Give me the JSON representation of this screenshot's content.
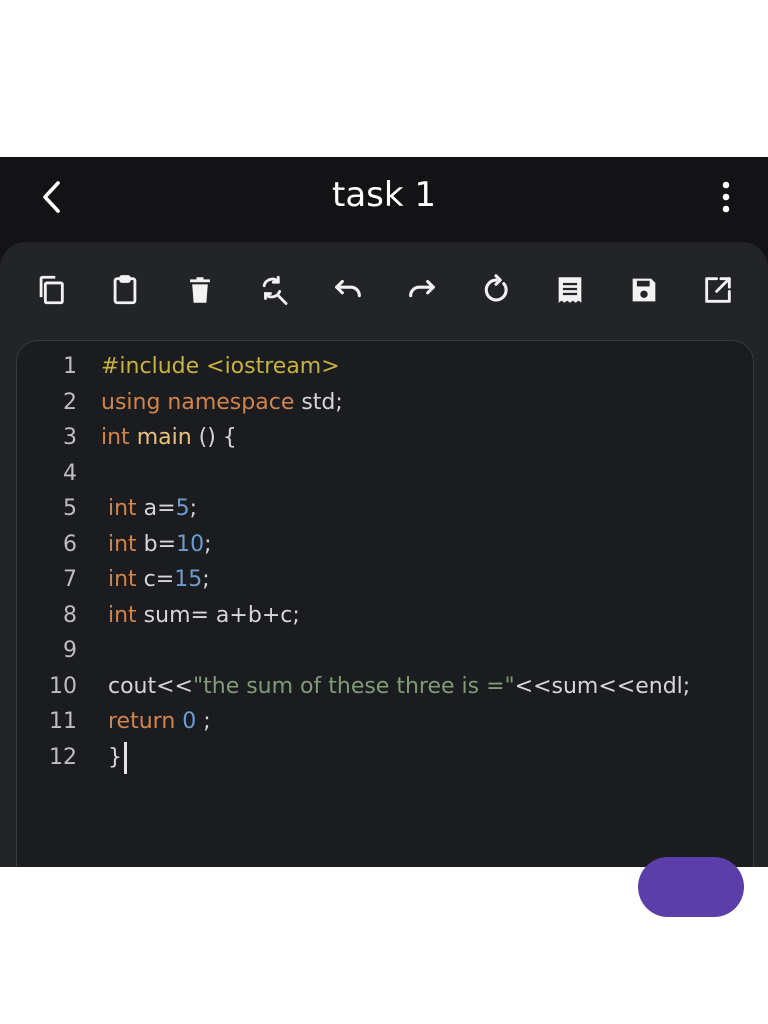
{
  "appbar": {
    "title": "task 1",
    "back_icon": "chevron-left-icon",
    "more_icon": "more-vertical-icon"
  },
  "toolbar": {
    "tools": [
      {
        "name": "copy",
        "icon": "copy-icon"
      },
      {
        "name": "paste",
        "icon": "clipboard-icon"
      },
      {
        "name": "delete",
        "icon": "trash-icon"
      },
      {
        "name": "find-replace",
        "icon": "find-replace-icon"
      },
      {
        "name": "undo",
        "icon": "undo-icon"
      },
      {
        "name": "redo",
        "icon": "redo-icon"
      },
      {
        "name": "reset",
        "icon": "refresh-icon"
      },
      {
        "name": "log",
        "icon": "receipt-icon"
      },
      {
        "name": "save",
        "icon": "save-icon"
      },
      {
        "name": "open-external",
        "icon": "open-external-icon"
      }
    ]
  },
  "editor": {
    "lines": [
      {
        "num": "1",
        "tokens": [
          {
            "t": "#include <iostream>",
            "c": "pre"
          }
        ]
      },
      {
        "num": "2",
        "tokens": [
          {
            "t": "using namespace ",
            "c": "kw"
          },
          {
            "t": "std;",
            "c": "pl"
          }
        ]
      },
      {
        "num": "3",
        "tokens": [
          {
            "t": "int ",
            "c": "kw"
          },
          {
            "t": "main",
            "c": "fn"
          },
          {
            "t": " () {",
            "c": "pl"
          }
        ]
      },
      {
        "num": "4",
        "tokens": []
      },
      {
        "num": "5",
        "tokens": [
          {
            "t": " int ",
            "c": "kw"
          },
          {
            "t": "a=",
            "c": "pl"
          },
          {
            "t": "5",
            "c": "num"
          },
          {
            "t": ";",
            "c": "pl"
          }
        ]
      },
      {
        "num": "6",
        "tokens": [
          {
            "t": " int ",
            "c": "kw"
          },
          {
            "t": "b=",
            "c": "pl"
          },
          {
            "t": "10",
            "c": "num"
          },
          {
            "t": ";",
            "c": "pl"
          }
        ]
      },
      {
        "num": "7",
        "tokens": [
          {
            "t": " int ",
            "c": "kw"
          },
          {
            "t": "c=",
            "c": "pl"
          },
          {
            "t": "15",
            "c": "num"
          },
          {
            "t": ";",
            "c": "pl"
          }
        ]
      },
      {
        "num": "8",
        "tokens": [
          {
            "t": " int ",
            "c": "kw"
          },
          {
            "t": "sum= a+b+c;",
            "c": "pl"
          }
        ]
      },
      {
        "num": "9",
        "tokens": []
      },
      {
        "num": "10",
        "tokens": [
          {
            "t": " cout<<",
            "c": "pl"
          },
          {
            "t": "\"the sum of these three is =\"",
            "c": "str"
          },
          {
            "t": "<<sum<<endl;",
            "c": "pl"
          }
        ]
      },
      {
        "num": "11",
        "tokens": [
          {
            "t": " return ",
            "c": "kw"
          },
          {
            "t": "0",
            "c": "num"
          },
          {
            "t": " ;",
            "c": "pl"
          }
        ]
      },
      {
        "num": "12",
        "tokens": [
          {
            "t": " }",
            "c": "pl"
          }
        ],
        "caret": true
      }
    ]
  },
  "colors": {
    "background": "#131316",
    "panel": "#232428",
    "editor": "#1b1c20",
    "preprocessor": "#c8b23c",
    "keyword": "#d2844a",
    "function": "#e9c27b",
    "number": "#6d9ccf",
    "string": "#7f9c73",
    "fab": "#5b3ea8"
  }
}
